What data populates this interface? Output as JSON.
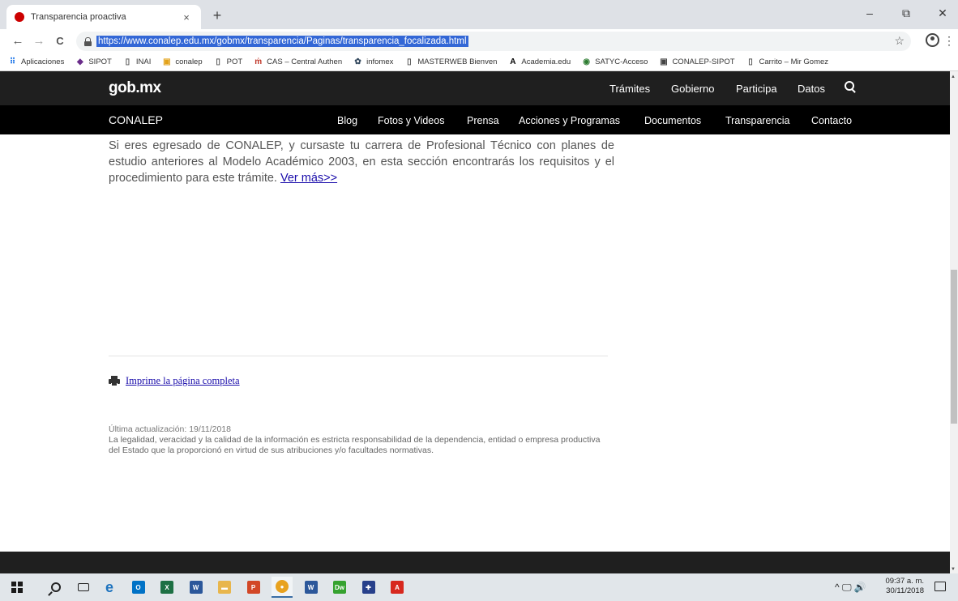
{
  "browser": {
    "tab": {
      "title": "Transparencia proactiva",
      "close": "×",
      "favicon": "red-circle-icon"
    },
    "new_tab": "+",
    "window_controls": {
      "minimize": "–",
      "maximize": "⧉",
      "close": "✕"
    },
    "nav": {
      "back": "←",
      "forward": "→",
      "reload": "C"
    },
    "url": "https://www.conalep.edu.mx/gobmx/transparencia/Paginas/transparencia_focalizada.html",
    "star": "☆",
    "menu": "⋮",
    "bookmarks": [
      {
        "label": "Aplicaciones",
        "icon": "apps-grid-icon",
        "glyph": "⠿",
        "color": "#1a73e8"
      },
      {
        "label": "SIPOT",
        "icon": "sipot-logo-icon",
        "glyph": "◆",
        "color": "#6a2c8a"
      },
      {
        "label": "INAI",
        "icon": "page-icon",
        "glyph": "▯",
        "color": "#555555"
      },
      {
        "label": "conalep",
        "icon": "conalep-logo-icon",
        "glyph": "▣",
        "color": "#e3a21a"
      },
      {
        "label": "POT",
        "icon": "page-icon",
        "glyph": "▯",
        "color": "#555555"
      },
      {
        "label": "CAS – Central Authen",
        "icon": "cas-logo-icon",
        "glyph": "ṁ",
        "color": "#c0392b"
      },
      {
        "label": "infomex",
        "icon": "infomex-logo-icon",
        "glyph": "✿",
        "color": "#34495e"
      },
      {
        "label": "MASTERWEB Bienven",
        "icon": "page-icon",
        "glyph": "▯",
        "color": "#555555"
      },
      {
        "label": "Academia.edu",
        "icon": "academia-logo-icon",
        "glyph": "A",
        "color": "#000000"
      },
      {
        "label": "SATYC-Acceso",
        "icon": "satyc-logo-icon",
        "glyph": "◉",
        "color": "#2e7d32"
      },
      {
        "label": "CONALEP-SIPOT",
        "icon": "conalep-sipot-logo-icon",
        "glyph": "▣",
        "color": "#444444"
      },
      {
        "label": "Carrito – Mir Gomez",
        "icon": "page-icon",
        "glyph": "▯",
        "color": "#555555"
      }
    ]
  },
  "site": {
    "logo": {
      "main": "gob",
      "dot": ".",
      "tld": "mx"
    },
    "top_nav": [
      "Trámites",
      "Gobierno",
      "Participa",
      "Datos"
    ],
    "brand": "CONALEP",
    "sub_nav": [
      "Blog",
      "Fotos y Videos",
      "Prensa",
      "Acciones y Programas",
      "Documentos",
      "Transparencia",
      "Contacto"
    ],
    "content": {
      "paragraph": "Si eres egresado de CONALEP, y cursaste tu carrera de Profesional Técnico con planes de estudio anteriores al Modelo Académico 2003, en esta sección  encontrarás los requisitos y el procedimiento para este trámite.",
      "ver_mas": "Ver más>>"
    },
    "print_link": "Imprime la página completa",
    "last_updated": "Última actualización: 19/11/2018",
    "disclaimer": "La legalidad, veracidad y la calidad de la información es estricta responsabilidad de la dependencia, entidad o empresa productiva del Estado que la proporcionó en virtud de sus atribuciones y/o facultades normativas."
  },
  "taskbar": {
    "apps": [
      {
        "name": "edge",
        "label": "e",
        "color": "#1e73be"
      },
      {
        "name": "outlook",
        "label": "O",
        "color": "#0072c6"
      },
      {
        "name": "excel",
        "label": "X",
        "color": "#1d7044"
      },
      {
        "name": "word",
        "label": "W",
        "color": "#2b579a"
      },
      {
        "name": "file-explorer",
        "label": "▬",
        "color": "#e8b64c"
      },
      {
        "name": "powerpoint",
        "label": "P",
        "color": "#d24726"
      },
      {
        "name": "chrome",
        "label": "●",
        "color": "#e8a21f"
      },
      {
        "name": "word-2",
        "label": "W",
        "color": "#2b579a"
      },
      {
        "name": "dreamweaver",
        "label": "Dw",
        "color": "#35a22f"
      },
      {
        "name": "uk-flag",
        "label": "✚",
        "color": "#27408b"
      },
      {
        "name": "acrobat",
        "label": "A",
        "color": "#d7281e"
      }
    ],
    "tray": "^ 🖵 🔊",
    "clock_time": "09:37 a. m.",
    "clock_date": "30/11/2018"
  }
}
